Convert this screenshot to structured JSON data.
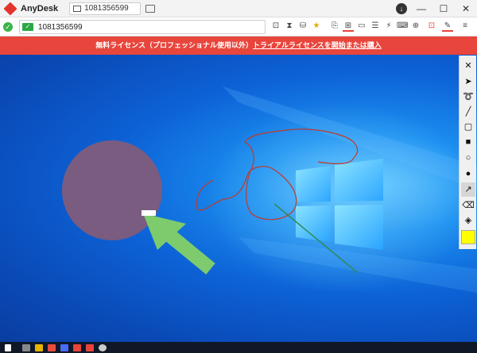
{
  "app": {
    "name": "AnyDesk"
  },
  "tab": {
    "label": "1081356599"
  },
  "window_controls": {
    "minimize": "—",
    "maximize": "☐",
    "close": "✕"
  },
  "address": {
    "id": "1081356599"
  },
  "banner": {
    "text_before": "無料ライセンス（プロフェッショナル使用以外）",
    "link_text": "トライアルライセンスを開始または購入"
  },
  "drawing_tools": [
    {
      "name": "close-tool",
      "glyph": "✕"
    },
    {
      "name": "pointer-tool",
      "glyph": "➤"
    },
    {
      "name": "whiteboard-pen-tool",
      "glyph": "➰"
    },
    {
      "name": "line-tool",
      "glyph": "╱"
    },
    {
      "name": "rectangle-outline-tool",
      "glyph": "▢"
    },
    {
      "name": "rectangle-filled-tool",
      "glyph": "■"
    },
    {
      "name": "circle-outline-tool",
      "glyph": "○"
    },
    {
      "name": "circle-filled-tool",
      "glyph": "●"
    },
    {
      "name": "arrow-tool",
      "glyph": "↗"
    },
    {
      "name": "eraser-tool",
      "glyph": "⌫"
    },
    {
      "name": "clear-all-tool",
      "glyph": "◈"
    },
    {
      "name": "color-picker",
      "glyph": ""
    }
  ],
  "colors": {
    "banner": "#e8453c",
    "accent": "#2aa845",
    "highlight": "#ffff00"
  }
}
